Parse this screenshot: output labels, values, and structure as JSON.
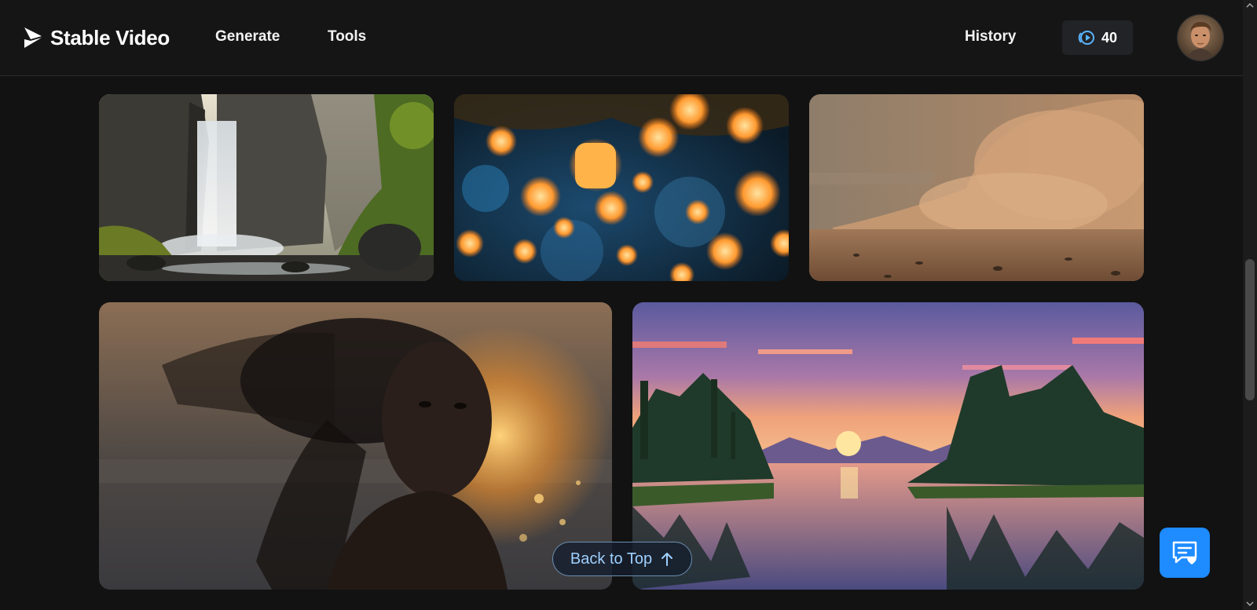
{
  "header": {
    "brand": "Stable Video",
    "nav": [
      {
        "label": "Generate"
      },
      {
        "label": "Tools"
      },
      {
        "label": "History"
      }
    ],
    "credits": "40",
    "avatar_icon": "user-avatar"
  },
  "gallery": {
    "items": [
      {
        "subject": "waterfall-image"
      },
      {
        "subject": "lanterns-image"
      },
      {
        "subject": "dust-storm-image"
      },
      {
        "subject": "portrait-image"
      },
      {
        "subject": "pixel-sunset-image"
      }
    ]
  },
  "back_to_top": {
    "label": "Back to Top"
  },
  "feedback": {
    "icon": "feedback-chat-icon"
  },
  "colors": {
    "background": "#121212",
    "accent": "#1e8bff",
    "back_to_top_text": "#9fd0ff"
  }
}
